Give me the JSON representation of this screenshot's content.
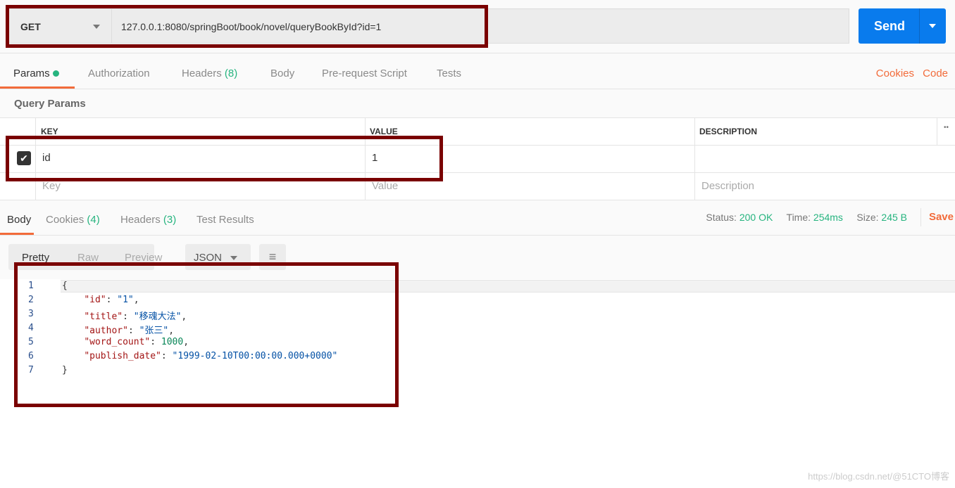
{
  "request": {
    "method": "GET",
    "url": "127.0.0.1:8080/springBoot/book/novel/queryBookById?id=1",
    "send_label": "Send"
  },
  "req_tabs": [
    {
      "label": "Params"
    },
    {
      "label": "Authorization"
    },
    {
      "label": "Headers",
      "count": "(8)"
    },
    {
      "label": "Body"
    },
    {
      "label": "Pre-request Script"
    },
    {
      "label": "Tests"
    }
  ],
  "links": {
    "cookies": "Cookies",
    "code": "Code"
  },
  "query_params": {
    "title": "Query Params",
    "headers": [
      "KEY",
      "VALUE",
      "DESCRIPTION"
    ],
    "rows": [
      {
        "checked": true,
        "key": "id",
        "value": "1",
        "description": ""
      }
    ],
    "placeholders": {
      "key": "Key",
      "value": "Value",
      "description": "Description"
    }
  },
  "resp_tabs": [
    {
      "label": "Body"
    },
    {
      "label": "Cookies",
      "count": "(4)"
    },
    {
      "label": "Headers",
      "count": "(3)"
    },
    {
      "label": "Test Results"
    }
  ],
  "status": {
    "status_label": "Status:",
    "status": "200 OK",
    "time_label": "Time:",
    "time": "254ms",
    "size_label": "Size:",
    "size": "245 B",
    "save": "Save"
  },
  "view": {
    "modes": [
      "Pretty",
      "Raw",
      "Preview"
    ],
    "format": "JSON"
  },
  "code_lines": [
    {
      "n": "1",
      "parts": [
        [
          "p",
          "{"
        ]
      ]
    },
    {
      "n": "2",
      "parts": [
        [
          "p",
          "    "
        ],
        [
          "k",
          "\"id\""
        ],
        [
          "p",
          ": "
        ],
        [
          "s",
          "\"1\""
        ],
        [
          "p",
          ","
        ]
      ]
    },
    {
      "n": "3",
      "parts": [
        [
          "p",
          "    "
        ],
        [
          "k",
          "\"title\""
        ],
        [
          "p",
          ": "
        ],
        [
          "s",
          "\"移魂大法\""
        ],
        [
          "p",
          ","
        ]
      ]
    },
    {
      "n": "4",
      "parts": [
        [
          "p",
          "    "
        ],
        [
          "k",
          "\"author\""
        ],
        [
          "p",
          ": "
        ],
        [
          "s",
          "\"张三\""
        ],
        [
          "p",
          ","
        ]
      ]
    },
    {
      "n": "5",
      "parts": [
        [
          "p",
          "    "
        ],
        [
          "k",
          "\"word_count\""
        ],
        [
          "p",
          ": "
        ],
        [
          "n",
          "1000"
        ],
        [
          "p",
          ","
        ]
      ]
    },
    {
      "n": "6",
      "parts": [
        [
          "p",
          "    "
        ],
        [
          "k",
          "\"publish_date\""
        ],
        [
          "p",
          ": "
        ],
        [
          "s",
          "\"1999-02-10T00:00:00.000+0000\""
        ]
      ]
    },
    {
      "n": "7",
      "parts": [
        [
          "p",
          "}"
        ]
      ]
    }
  ],
  "watermark": "https://blog.csdn.net/@51CTO博客",
  "colors": {
    "accent": "#097bed",
    "active_tab": "#f26b3a",
    "success": "#26b47f",
    "annotation": "#7a0000"
  }
}
